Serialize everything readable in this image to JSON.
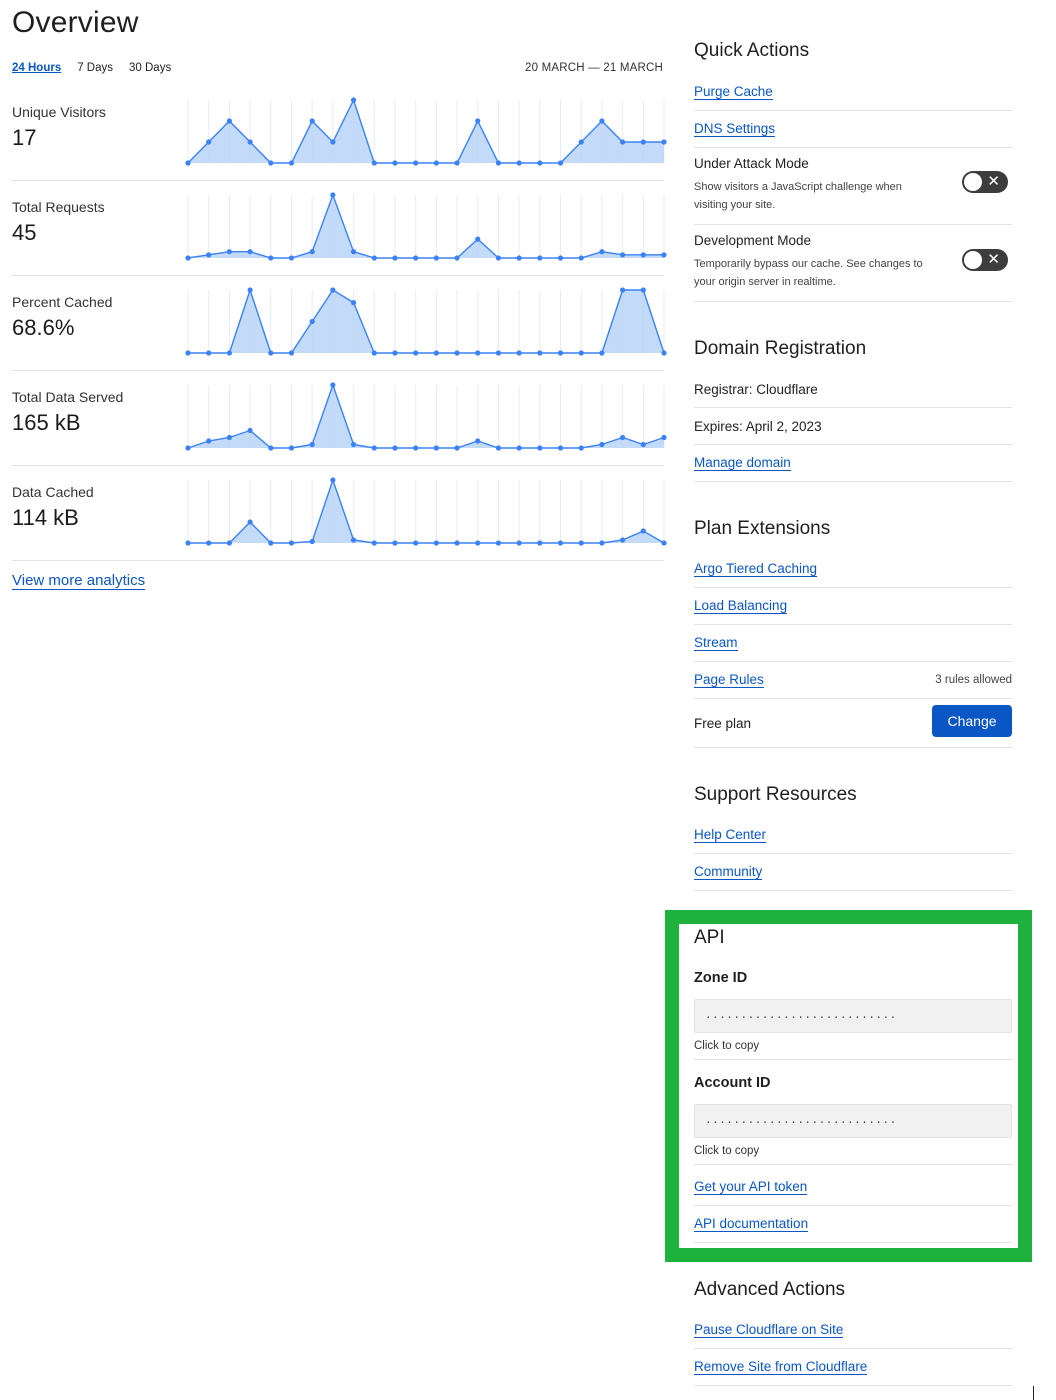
{
  "page": {
    "title": "Overview"
  },
  "time_range": {
    "options": [
      "24 Hours",
      "7 Days",
      "30 Days"
    ],
    "selected": "24 Hours",
    "date_range": "20 MARCH — 21 MARCH"
  },
  "metrics": [
    {
      "label": "Unique Visitors",
      "value": "17"
    },
    {
      "label": "Total Requests",
      "value": "45"
    },
    {
      "label": "Percent Cached",
      "value": "68.6%"
    },
    {
      "label": "Total Data Served",
      "value": "165 kB"
    },
    {
      "label": "Data Cached",
      "value": "114 kB"
    }
  ],
  "more_link": "View more analytics",
  "chart_data": [
    {
      "type": "area",
      "series_of": "Unique Visitors",
      "values": [
        0,
        1,
        2,
        1,
        0,
        0,
        2,
        1,
        3,
        0,
        0,
        0,
        0,
        0,
        2,
        0,
        0,
        0,
        0,
        1,
        2,
        1,
        1,
        1
      ]
    },
    {
      "type": "area",
      "series_of": "Total Requests",
      "values": [
        0,
        0.5,
        1,
        1,
        0,
        0,
        1,
        10,
        1,
        0,
        0,
        0,
        0,
        0,
        3,
        0,
        0,
        0,
        0,
        0,
        1,
        0.5,
        0.5,
        0.5
      ]
    },
    {
      "type": "area",
      "series_of": "Percent Cached",
      "values": [
        0,
        0,
        0,
        100,
        0,
        0,
        50,
        100,
        80,
        0,
        0,
        0,
        0,
        0,
        0,
        0,
        0,
        0,
        0,
        0,
        0,
        100,
        100,
        0
      ]
    },
    {
      "type": "area",
      "series_of": "Total Data Served",
      "values": [
        0,
        2,
        3,
        5,
        0,
        0,
        1,
        18,
        1,
        0,
        0,
        0,
        0,
        0,
        2,
        0,
        0,
        0,
        0,
        0,
        1,
        3,
        1,
        3
      ]
    },
    {
      "type": "area",
      "series_of": "Data Cached",
      "values": [
        0,
        0,
        0,
        7,
        0,
        0,
        0.5,
        21,
        1,
        0,
        0,
        0,
        0,
        0,
        0,
        0,
        0,
        0,
        0,
        0,
        0,
        1,
        4,
        0
      ]
    }
  ],
  "quick_actions": {
    "title": "Quick Actions",
    "links": [
      "Purge Cache",
      "DNS Settings"
    ],
    "toggles": [
      {
        "label": "Under Attack Mode",
        "description": "Show visitors a JavaScript challenge when visiting your site.",
        "state": "off"
      },
      {
        "label": "Development Mode",
        "description": "Temporarily bypass our cache. See changes to your origin server in realtime.",
        "state": "off"
      }
    ]
  },
  "domain_registration": {
    "title": "Domain Registration",
    "registrar": "Registrar: Cloudflare",
    "expires": "Expires: April 2, 2023",
    "manage": "Manage domain"
  },
  "plan_extensions": {
    "title": "Plan Extensions",
    "links": [
      "Argo Tiered Caching",
      "Load Balancing",
      "Stream",
      "Page Rules"
    ],
    "page_rules_note": "3 rules allowed",
    "plan": "Free plan",
    "change_label": "Change"
  },
  "support": {
    "title": "Support Resources",
    "links": [
      "Help Center",
      "Community"
    ]
  },
  "api": {
    "title": "API",
    "zone_label": "Zone ID",
    "zone_value": "...........................",
    "account_label": "Account ID",
    "account_value": "...........................",
    "copy_hint": "Click to copy",
    "token_link": "Get your API token",
    "docs_link": "API documentation",
    "highlight_color": "#1fb13d"
  },
  "advanced": {
    "title": "Advanced Actions",
    "links": [
      "Pause Cloudflare on Site",
      "Remove Site from Cloudflare"
    ]
  },
  "colors": {
    "accent": "#0a56c4",
    "chart_line": "#3b82f6",
    "chart_fill": "#b9d3f7"
  }
}
